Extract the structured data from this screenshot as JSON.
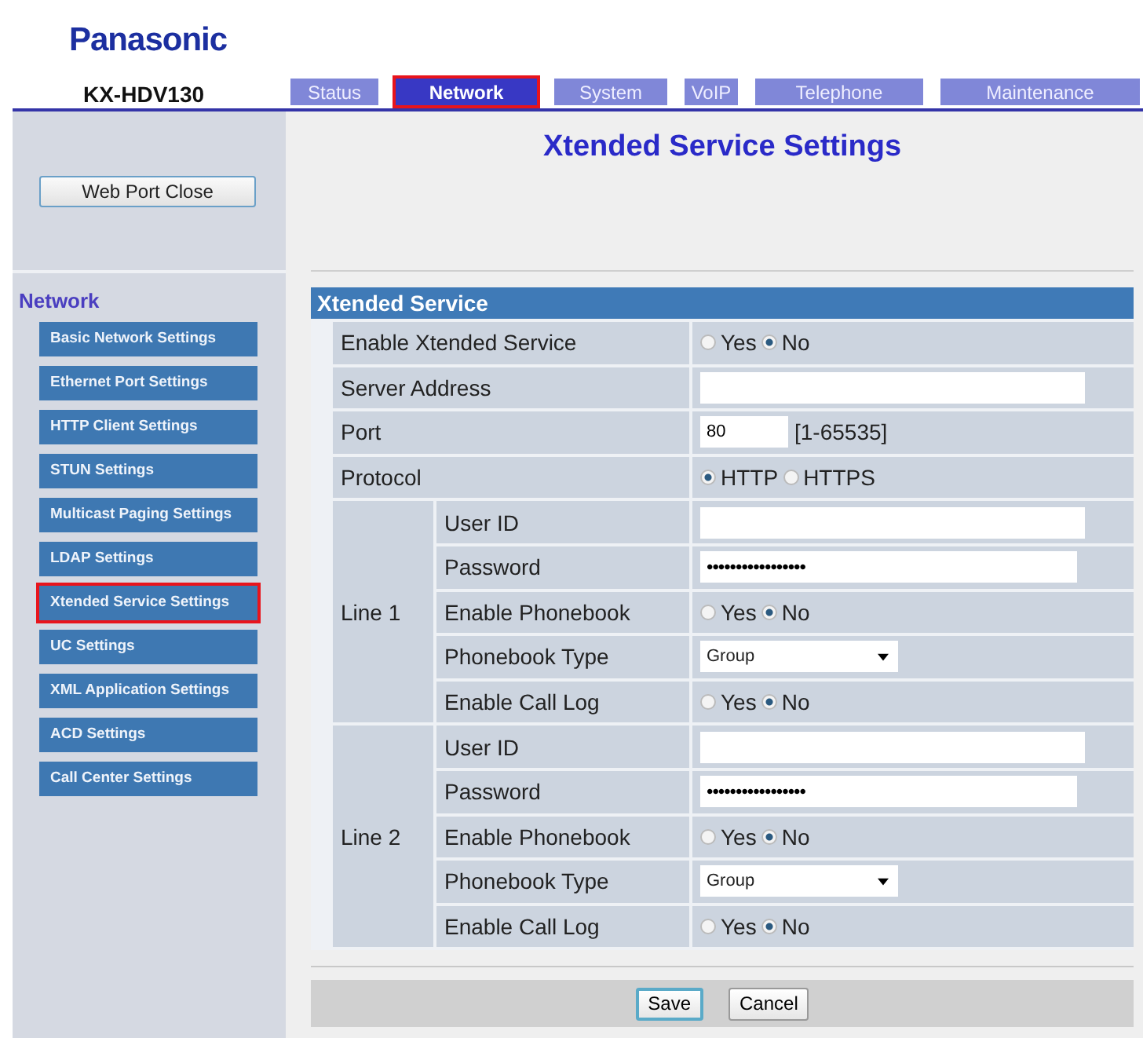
{
  "header": {
    "logo": "Panasonic",
    "model": "KX-HDV130"
  },
  "tabs": [
    {
      "label": "Status",
      "selected": false,
      "highlighted": false
    },
    {
      "label": "Network",
      "selected": true,
      "highlighted": true
    },
    {
      "label": "System",
      "selected": false,
      "highlighted": false
    },
    {
      "label": "VoIP",
      "selected": false,
      "highlighted": false
    },
    {
      "label": "Telephone",
      "selected": false,
      "highlighted": false
    },
    {
      "label": "Maintenance",
      "selected": false,
      "highlighted": false
    }
  ],
  "web_port_button": "Web Port Close",
  "page_title": "Xtended Service Settings",
  "sidebar": {
    "heading": "Network",
    "items": [
      {
        "label": "Basic Network Settings",
        "highlighted": false
      },
      {
        "label": "Ethernet Port Settings",
        "highlighted": false
      },
      {
        "label": "HTTP Client Settings",
        "highlighted": false
      },
      {
        "label": "STUN Settings",
        "highlighted": false
      },
      {
        "label": "Multicast Paging Settings",
        "highlighted": false
      },
      {
        "label": "LDAP Settings",
        "highlighted": false
      },
      {
        "label": "Xtended Service Settings",
        "highlighted": true
      },
      {
        "label": "UC Settings",
        "highlighted": false
      },
      {
        "label": "XML Application Settings",
        "highlighted": false
      },
      {
        "label": "ACD Settings",
        "highlighted": false
      },
      {
        "label": "Call Center Settings",
        "highlighted": false
      }
    ]
  },
  "section": {
    "title": "Xtended Service",
    "rows": [
      {
        "label": "Enable Xtended Service",
        "kind": "radio",
        "options": [
          {
            "label": "Yes",
            "selected": false
          },
          {
            "label": "No",
            "selected": true
          }
        ]
      },
      {
        "label": "Server Address",
        "kind": "text"
      },
      {
        "label": "Port",
        "kind": "short",
        "value": "80",
        "hint": "[1-65535]"
      },
      {
        "label": "Protocol",
        "kind": "radio",
        "options": [
          {
            "label": "HTTP",
            "selected": true
          },
          {
            "label": "HTTPS",
            "selected": false
          }
        ]
      }
    ],
    "lines": [
      {
        "label": "Line 1",
        "rows": [
          {
            "label": "User ID",
            "kind": "text"
          },
          {
            "label": "Password",
            "kind": "password",
            "value": "•••••••••••••••••"
          },
          {
            "label": "Enable Phonebook",
            "kind": "radio",
            "options": [
              {
                "label": "Yes",
                "selected": false
              },
              {
                "label": "No",
                "selected": true
              }
            ]
          },
          {
            "label": "Phonebook Type",
            "kind": "select",
            "value": "Group"
          },
          {
            "label": "Enable Call Log",
            "kind": "radio",
            "options": [
              {
                "label": "Yes",
                "selected": false
              },
              {
                "label": "No",
                "selected": true
              }
            ]
          }
        ]
      },
      {
        "label": "Line 2",
        "rows": [
          {
            "label": "User ID",
            "kind": "text"
          },
          {
            "label": "Password",
            "kind": "password",
            "value": "•••••••••••••••••"
          },
          {
            "label": "Enable Phonebook",
            "kind": "radio",
            "options": [
              {
                "label": "Yes",
                "selected": false
              },
              {
                "label": "No",
                "selected": true
              }
            ]
          },
          {
            "label": "Phonebook Type",
            "kind": "select",
            "value": "Group"
          },
          {
            "label": "Enable Call Log",
            "kind": "radio",
            "options": [
              {
                "label": "Yes",
                "selected": false
              },
              {
                "label": "No",
                "selected": true
              }
            ]
          }
        ]
      }
    ]
  },
  "buttons": [
    {
      "label": "Save",
      "focused": true
    },
    {
      "label": "Cancel",
      "focused": false
    }
  ]
}
